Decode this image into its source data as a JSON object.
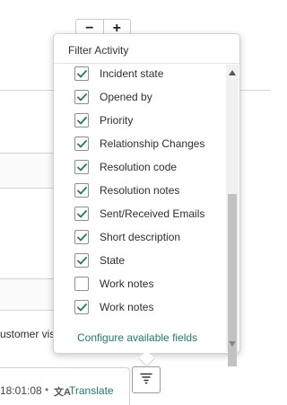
{
  "toolbar": {
    "zoom_out": "−",
    "zoom_in": "+"
  },
  "background": {
    "partial_text": "ustomer vis",
    "entry_time": "18:01:08",
    "separator": "•",
    "translate_icon": "文A",
    "translate_label": "Translate"
  },
  "filter_popover": {
    "title": "Filter Activity",
    "items": [
      {
        "label": "Incident state",
        "checked": true
      },
      {
        "label": "Opened by",
        "checked": true
      },
      {
        "label": "Priority",
        "checked": true
      },
      {
        "label": "Relationship Changes",
        "checked": true
      },
      {
        "label": "Resolution code",
        "checked": true
      },
      {
        "label": "Resolution notes",
        "checked": true
      },
      {
        "label": "Sent/Received Emails",
        "checked": true
      },
      {
        "label": "Short description",
        "checked": true
      },
      {
        "label": "State",
        "checked": true
      },
      {
        "label": "Work notes",
        "checked": false
      },
      {
        "label": "Work notes",
        "checked": true
      }
    ],
    "configure_link": "Configure available fields"
  },
  "colors": {
    "accent": "#1f7a6a",
    "checkmark": "#1f7a6a"
  },
  "icons": {
    "filter": "funnel-icon",
    "check": "checkmark-icon"
  }
}
